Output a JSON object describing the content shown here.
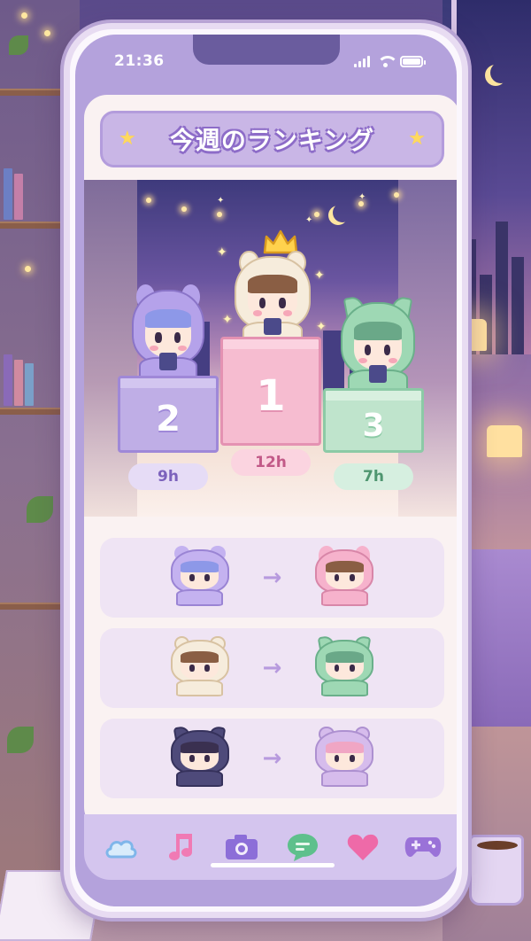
{
  "status_bar": {
    "time": "21:36"
  },
  "header": {
    "title": "今週のランキング"
  },
  "podium": [
    {
      "rank": "2",
      "hours": "9h",
      "character": "purple-bear-hoodie"
    },
    {
      "rank": "1",
      "hours": "12h",
      "character": "cream-bear-hoodie"
    },
    {
      "rank": "3",
      "hours": "7h",
      "character": "green-cat-hoodie"
    }
  ],
  "swaps": [
    {
      "from": "purple-bear-hoodie",
      "to": "pink-bunny-hoodie"
    },
    {
      "from": "cream-bear-hoodie",
      "to": "green-cat-hoodie"
    },
    {
      "from": "navy-cat-hoodie",
      "to": "lilac-bear-hoodie"
    }
  ],
  "nav": {
    "items": [
      {
        "icon": "cloud-icon",
        "color": "#7fb6ea"
      },
      {
        "icon": "music-note-icon",
        "color": "#f07ab4"
      },
      {
        "icon": "camera-icon",
        "color": "#8c6ed8"
      },
      {
        "icon": "chat-bubble-icon",
        "color": "#5ec08c"
      },
      {
        "icon": "heart-icon",
        "color": "#ee6aa8"
      },
      {
        "icon": "gamepad-icon",
        "color": "#9a72d8"
      }
    ]
  },
  "colors": {
    "accent": "#b39cdc",
    "rank1": "#f6bcd0",
    "rank2": "#bfaee6",
    "rank3": "#bfe4cc"
  }
}
